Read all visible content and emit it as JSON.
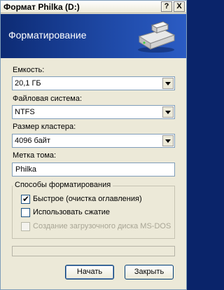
{
  "window": {
    "title": "Формат Philka (D:)",
    "help_label": "?",
    "close_label": "X",
    "banner_title": "Форматирование"
  },
  "capacity": {
    "label": "Емкость:",
    "value": "20,1 ГБ"
  },
  "filesystem": {
    "label": "Файловая система:",
    "value": "NTFS"
  },
  "cluster_size": {
    "label": "Размер кластера:",
    "value": "4096 байт"
  },
  "volume_label": {
    "label": "Метка тома:",
    "value": "Philka"
  },
  "format_options": {
    "title": "Способы форматирования",
    "quick_format": {
      "label": "Быстрое (очистка оглавления)",
      "checked": true,
      "check_mark": "✔"
    },
    "compression": {
      "label": "Использовать сжатие",
      "checked": false
    },
    "boot_disk": {
      "label": "Создание загрузочного диска MS-DOS",
      "checked": false,
      "disabled": true
    }
  },
  "progress": {
    "value": 0
  },
  "buttons": {
    "start": "Начать",
    "close": "Закрыть"
  },
  "icons": {
    "drive": "drive-icon",
    "dropdown": "chevron-down-icon",
    "check": "check-icon"
  }
}
